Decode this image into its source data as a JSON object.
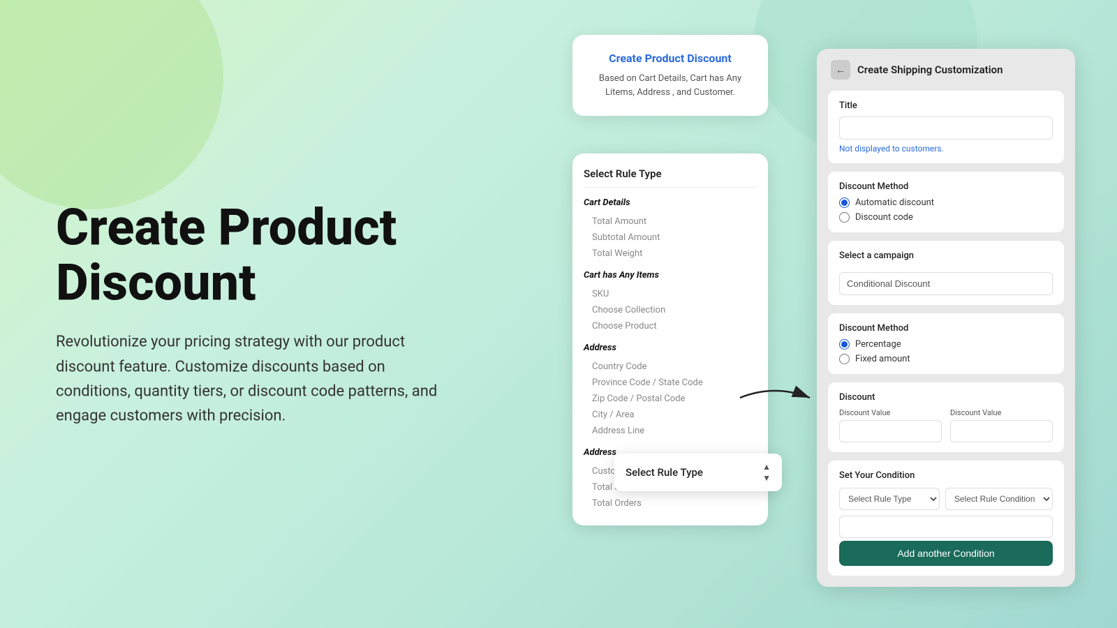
{
  "background": {
    "gradient": "linear-gradient(135deg, #d4f5c4 0%, #c8f0e0 30%, #b8e8d8 60%, #a0d8d0 100%)"
  },
  "hero": {
    "title": "Create Product Discount",
    "description": "Revolutionize your pricing strategy with our product discount feature. Customize discounts based on conditions, quantity tiers, or discount code patterns, and engage customers with precision."
  },
  "info_card": {
    "title": "Create Product Discount",
    "description": "Based on Cart Details, Cart has Any Litems, Address , and Customer."
  },
  "rule_type_panel": {
    "header": "Select Rule Type",
    "groups": [
      {
        "title": "Cart Details",
        "items": [
          "Total Amount",
          "Subtotal Amount",
          "Total Weight"
        ]
      },
      {
        "title": "Cart has Any Items",
        "items": [
          "SKU",
          "Choose Collection",
          "Choose Product"
        ]
      },
      {
        "title": "Address",
        "items": [
          "Country Code",
          "Province Code / State Code",
          "Zip Code / Postal Code",
          "City / Area",
          "Address Line"
        ]
      },
      {
        "title": "Address",
        "items": [
          "Customer Tags",
          "Total Spend",
          "Total Orders"
        ]
      }
    ]
  },
  "floating_dropdown": {
    "label": "Select Rule Type"
  },
  "shipping_panel": {
    "header": "Create Shipping Customization",
    "back_label": "←",
    "title_field": {
      "label": "Title",
      "placeholder": "",
      "not_displayed": "Not displayed to customers."
    },
    "discount_method_section": {
      "label": "Discount Method",
      "options": [
        {
          "label": "Automatic discount",
          "checked": true
        },
        {
          "label": "Discount code",
          "checked": false
        }
      ]
    },
    "campaign_section": {
      "label": "Select a campaign",
      "value": "Conditional Discount"
    },
    "discount_method2_section": {
      "label": "Discount Method",
      "options": [
        {
          "label": "Percentage",
          "checked": true
        },
        {
          "label": "Fixed amount",
          "checked": false
        }
      ]
    },
    "discount_section": {
      "label": "Discount",
      "fields": [
        {
          "label": "Discount Value"
        },
        {
          "label": "Discount Value"
        }
      ]
    },
    "condition_section": {
      "label": "Set Your Condition",
      "rule_type_placeholder": "Select Rule Type",
      "rule_condition_placeholder": "Select Rule Condition",
      "value_placeholder": "",
      "add_condition_label": "Add another Condition"
    }
  }
}
